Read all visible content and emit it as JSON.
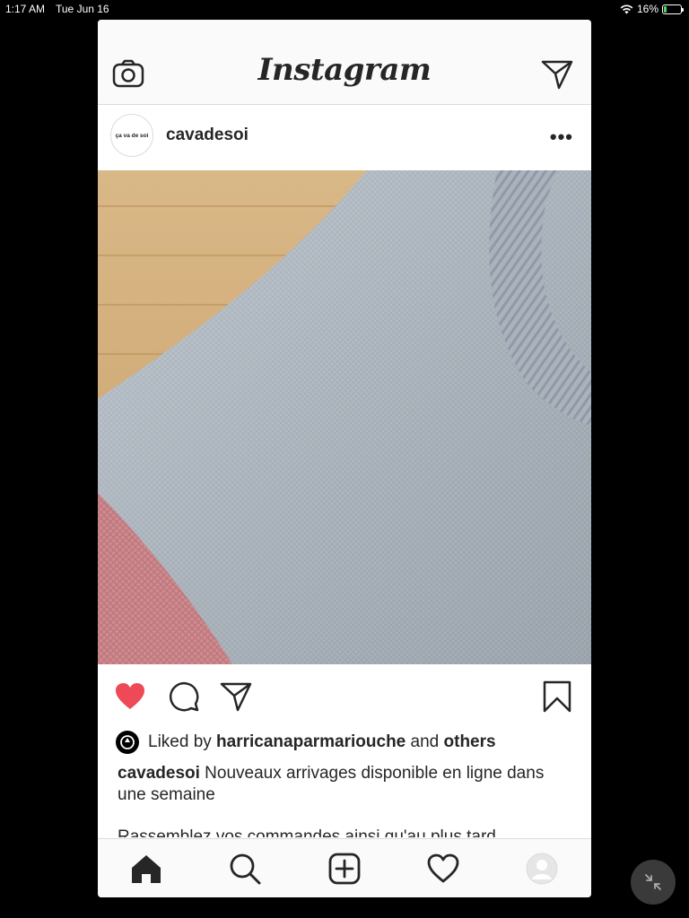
{
  "status_bar": {
    "time": "1:17 AM",
    "date": "Tue Jun 16",
    "battery": "16%",
    "battery_level": 0.16
  },
  "app": {
    "logo": "Instagram"
  },
  "icons": {
    "camera": "camera-icon",
    "direct": "paper-plane-icon",
    "like": "heart-filled-icon",
    "comment": "speech-bubble-icon",
    "share": "paper-plane-icon",
    "save": "bookmark-icon",
    "home": "home-icon",
    "search": "search-icon",
    "add": "plus-square-icon",
    "activity": "heart-outline-icon",
    "profile": "profile-icon"
  },
  "post": {
    "avatar_text": "ça va de soi",
    "username": "cavadesoi",
    "liked_by_prefix": "Liked by ",
    "liked_by_user": "harricanaparmariouche",
    "liked_by_mid": " and ",
    "liked_by_suffix": "others",
    "caption_user": "cavadesoi",
    "caption_text": " Nouveaux arrivages disponible en ligne dans une semaine",
    "caption_more": "Rassemblez vos commandes ainsi qu'au plus tard"
  },
  "colors": {
    "like_red": "#ed4956",
    "text": "#262626",
    "border": "#dbdbdb"
  }
}
